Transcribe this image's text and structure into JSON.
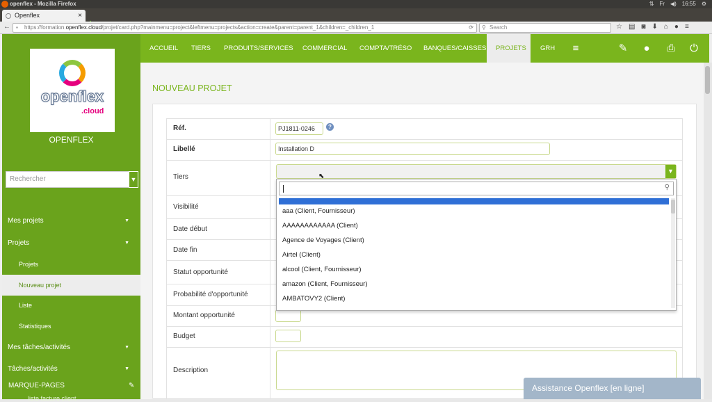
{
  "browser": {
    "window_title": "openflex - Mozilla Firefox",
    "tab_title": "Openflex",
    "url_prefix": "https://formation.",
    "url_domain": "openflex.cloud",
    "url_rest": "/projet/card.php?mainmenu=project&leftmenu=projects&action=create&parent=parent_1&children=_children_1",
    "search_placeholder": "Search",
    "clock": "16:55",
    "kbd": "Fr",
    "tab_close": "×",
    "new_tab": "+",
    "back": "←",
    "reload": "⟳"
  },
  "sidebar": {
    "brand": "OPENFLEX",
    "logo_word": "openflex",
    "logo_cloud": ".cloud",
    "search_placeholder": "Rechercher",
    "items": [
      {
        "label": "Mes projets",
        "caret": "▼"
      },
      {
        "label": "Projets",
        "caret": "▼"
      },
      {
        "label": "Projets"
      },
      {
        "label": "Nouveau projet"
      },
      {
        "label": "Liste"
      },
      {
        "label": "Statistiques"
      },
      {
        "label": "Mes tâches/activités",
        "caret": "▼"
      },
      {
        "label": "Tâches/activités",
        "caret": "▼"
      }
    ],
    "marque": "MARQUE-PAGES",
    "marque_sub": "liste facture client"
  },
  "topmenu": {
    "items": [
      "ACCUEIL",
      "TIERS",
      "PRODUITS/SERVICES",
      "COMMERCIAL",
      "COMPTA/TRÉSO",
      "BANQUES/CAISSES",
      "PROJETS",
      "GRH"
    ],
    "active": "PROJETS"
  },
  "page": {
    "title": "NOUVEAU PROJET"
  },
  "form": {
    "ref_label": "Réf.",
    "ref_value": "PJ1811-0246",
    "libelle_label": "Libellé",
    "libelle_value": "Installation D",
    "tiers_label": "Tiers",
    "visibilite_label": "Visibilité",
    "date_debut_label": "Date début",
    "date_fin_label": "Date fin",
    "statut_label": "Statut opportunité",
    "proba_label": "Probabilité d'opportunité",
    "montant_label": "Montant opportunité",
    "budget_label": "Budget",
    "description_label": "Description"
  },
  "dropdown": {
    "options": [
      "aaa (Client, Fournisseur)",
      "AAAAAAAAAAAA (Client)",
      "Agence de Voyages (Client)",
      "Airtel (Client)",
      "alcool (Client, Fournisseur)",
      "amazon (Client, Fournisseur)",
      "AMBATOVY2 (Client)"
    ]
  },
  "chat": {
    "label": "Assistance Openflex [en ligne]"
  },
  "colors": {
    "brand_green": "#7ab51d",
    "sidebar_green": "#6aa31c",
    "highlight_blue": "#2f6fd6"
  }
}
